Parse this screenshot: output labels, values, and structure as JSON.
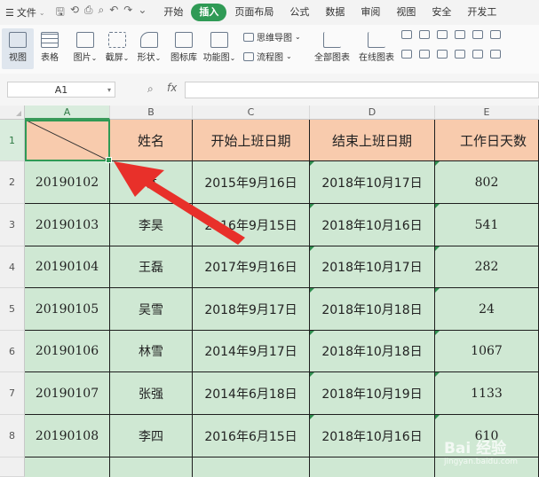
{
  "menubar": {
    "file_label": "文件",
    "tabs": [
      "开始",
      "插入",
      "页面布局",
      "公式",
      "数据",
      "审阅",
      "视图",
      "安全",
      "开发工"
    ],
    "active_tab": "插入"
  },
  "ribbon": {
    "view_label": "视图",
    "table_label": "表格",
    "picture_label": "图片",
    "screenshot_label": "截屏",
    "shape_label": "形状",
    "icon_lib_label": "图标库",
    "func_chart_label": "功能图",
    "mindmap_label": "思维导图",
    "flowchart_label": "流程图",
    "all_charts_label": "全部图表",
    "online_charts_label": "在线图表"
  },
  "formula_bar": {
    "cell_ref": "A1",
    "fx_label": "fx",
    "formula_value": ""
  },
  "columns": [
    "A",
    "B",
    "C",
    "D",
    "E"
  ],
  "rows": [
    "1",
    "2",
    "3",
    "4",
    "5",
    "6",
    "7",
    "8"
  ],
  "table": {
    "headers": [
      "",
      "姓名",
      "开始上班日期",
      "结束上班日期",
      "工作日天数"
    ],
    "data": [
      [
        "20190102",
        "林",
        "2015年9月16日",
        "2018年10月17日",
        "802"
      ],
      [
        "20190103",
        "李昊",
        "2016年9月15日",
        "2018年10月16日",
        "541"
      ],
      [
        "20190104",
        "王磊",
        "2017年9月16日",
        "2018年10月17日",
        "282"
      ],
      [
        "20190105",
        "吴雪",
        "2018年9月17日",
        "2018年10月18日",
        "24"
      ],
      [
        "20190106",
        "林雪",
        "2014年9月17日",
        "2018年10月18日",
        "1067"
      ],
      [
        "20190107",
        "张强",
        "2014年6月18日",
        "2018年10月19日",
        "1133"
      ],
      [
        "20190108",
        "李四",
        "2016年6月15日",
        "2018年10月16日",
        "610"
      ]
    ]
  },
  "watermark": {
    "brand": "Bai 经验",
    "url": "jingyan.baidu.com"
  },
  "colors": {
    "accent": "#2f9a55",
    "header_fill": "#f8cbad",
    "body_fill": "#cfe8d3",
    "annotation_arrow": "#e8302a"
  }
}
